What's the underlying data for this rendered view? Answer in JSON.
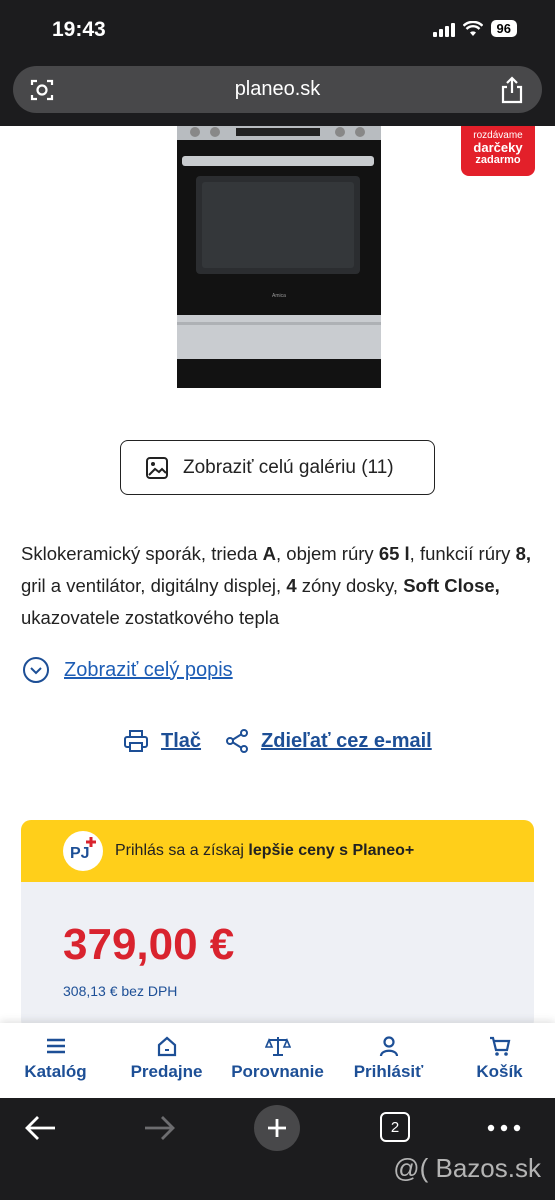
{
  "status_bar": {
    "time": "19:43",
    "battery": "96"
  },
  "browser": {
    "url": "planeo.sk",
    "tab_count": "2"
  },
  "promo_badge": {
    "line1": "rozdávame",
    "line2": "darčeky",
    "line3": "zadarmo"
  },
  "product": {
    "image_icon": "oven-image"
  },
  "gallery_button": {
    "label": "Zobraziť celú galériu (11)"
  },
  "description": {
    "p1": "Sklokeramický sporák, trieda ",
    "b1": "A",
    "p2": ", objem rúry ",
    "b2": "65 l",
    "p3": ", funkcií rúry ",
    "b3": "8,",
    "p4": " gril a ventilátor, digitálny displej, ",
    "b4": "4",
    "p5": " zóny dosky, ",
    "b5": "Soft Close,",
    "p6": " ukazovatele zostatkového tepla"
  },
  "show_more": {
    "label": "Zobraziť celý popis"
  },
  "actions": {
    "print": "Tlač",
    "share": "Zdieľať cez e-mail"
  },
  "loyalty": {
    "text_prefix": "Prihlás sa a získaj ",
    "text_bold": "lepšie ceny s Planeo+"
  },
  "price": {
    "main": "379,00 €",
    "net": "308,13 € bez DPH"
  },
  "bottom_nav": [
    {
      "label": "Katalóg",
      "icon": "menu-icon"
    },
    {
      "label": "Predajne",
      "icon": "home-icon"
    },
    {
      "label": "Porovnanie",
      "icon": "scale-icon"
    },
    {
      "label": "Prihlásiť",
      "icon": "user-icon"
    },
    {
      "label": "Košík",
      "icon": "cart-icon"
    }
  ],
  "watermark": "@( Bazos.sk",
  "colors": {
    "accent_blue": "#1d4f96",
    "price_red": "#d9232e",
    "banner_yellow": "#ffcf1a"
  }
}
